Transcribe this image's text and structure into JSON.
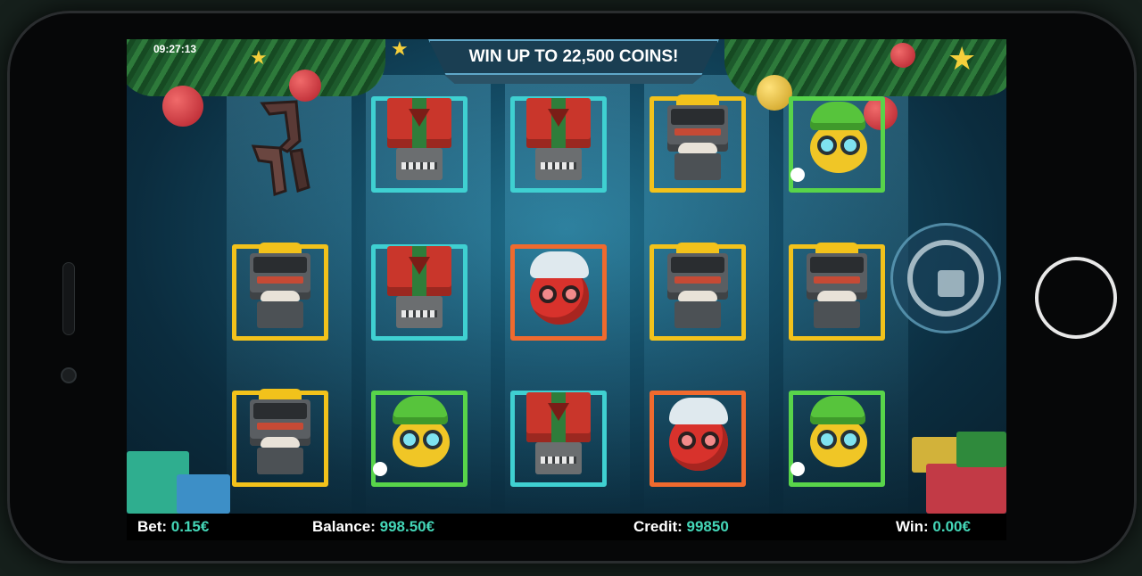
{
  "clock": "09:27:13",
  "banner": {
    "text": "WIN UP TO 22,500 COINS!"
  },
  "reels": {
    "rows": [
      [
        "claw",
        "gift-robot",
        "gift-robot",
        "robot-chef",
        "elf-ball"
      ],
      [
        "robot-chef",
        "gift-robot",
        "cat-ball",
        "robot-chef",
        "robot-chef"
      ],
      [
        "robot-chef",
        "elf-ball",
        "gift-robot",
        "cat-ball",
        "elf-ball"
      ]
    ]
  },
  "status": {
    "bet_label": "Bet:",
    "bet_value": "0.15€",
    "balance_label": "Balance:",
    "balance_value": "998.50€",
    "credit_label": "Credit:",
    "credit_value": "99850",
    "win_label": "Win:",
    "win_value": "0.00€"
  },
  "colors": {
    "accent": "#44d6b7",
    "frame_yellow": "#f2c21b",
    "frame_teal": "#3fd0d1",
    "frame_green": "#58d44a",
    "frame_orange": "#ef6a2e"
  },
  "icons": [
    "spin-icon",
    "claw-icon",
    "home-button-icon"
  ]
}
